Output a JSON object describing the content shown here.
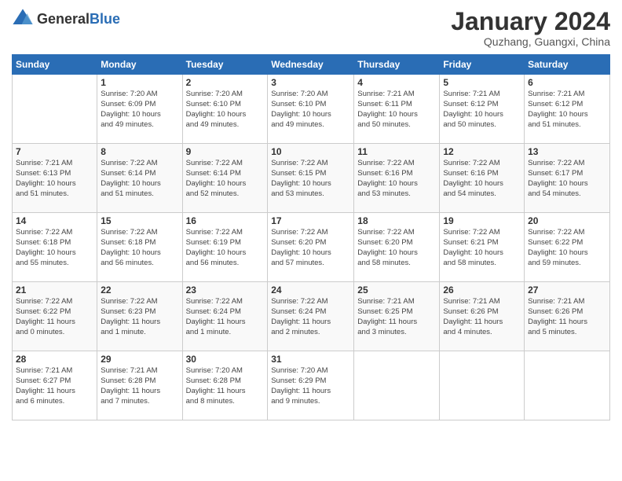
{
  "logo": {
    "general": "General",
    "blue": "Blue"
  },
  "header": {
    "month": "January 2024",
    "location": "Quzhang, Guangxi, China"
  },
  "days_of_week": [
    "Sunday",
    "Monday",
    "Tuesday",
    "Wednesday",
    "Thursday",
    "Friday",
    "Saturday"
  ],
  "weeks": [
    [
      {
        "day": "",
        "info": ""
      },
      {
        "day": "1",
        "info": "Sunrise: 7:20 AM\nSunset: 6:09 PM\nDaylight: 10 hours\nand 49 minutes."
      },
      {
        "day": "2",
        "info": "Sunrise: 7:20 AM\nSunset: 6:10 PM\nDaylight: 10 hours\nand 49 minutes."
      },
      {
        "day": "3",
        "info": "Sunrise: 7:20 AM\nSunset: 6:10 PM\nDaylight: 10 hours\nand 49 minutes."
      },
      {
        "day": "4",
        "info": "Sunrise: 7:21 AM\nSunset: 6:11 PM\nDaylight: 10 hours\nand 50 minutes."
      },
      {
        "day": "5",
        "info": "Sunrise: 7:21 AM\nSunset: 6:12 PM\nDaylight: 10 hours\nand 50 minutes."
      },
      {
        "day": "6",
        "info": "Sunrise: 7:21 AM\nSunset: 6:12 PM\nDaylight: 10 hours\nand 51 minutes."
      }
    ],
    [
      {
        "day": "7",
        "info": "Sunrise: 7:21 AM\nSunset: 6:13 PM\nDaylight: 10 hours\nand 51 minutes."
      },
      {
        "day": "8",
        "info": "Sunrise: 7:22 AM\nSunset: 6:14 PM\nDaylight: 10 hours\nand 51 minutes."
      },
      {
        "day": "9",
        "info": "Sunrise: 7:22 AM\nSunset: 6:14 PM\nDaylight: 10 hours\nand 52 minutes."
      },
      {
        "day": "10",
        "info": "Sunrise: 7:22 AM\nSunset: 6:15 PM\nDaylight: 10 hours\nand 53 minutes."
      },
      {
        "day": "11",
        "info": "Sunrise: 7:22 AM\nSunset: 6:16 PM\nDaylight: 10 hours\nand 53 minutes."
      },
      {
        "day": "12",
        "info": "Sunrise: 7:22 AM\nSunset: 6:16 PM\nDaylight: 10 hours\nand 54 minutes."
      },
      {
        "day": "13",
        "info": "Sunrise: 7:22 AM\nSunset: 6:17 PM\nDaylight: 10 hours\nand 54 minutes."
      }
    ],
    [
      {
        "day": "14",
        "info": "Sunrise: 7:22 AM\nSunset: 6:18 PM\nDaylight: 10 hours\nand 55 minutes."
      },
      {
        "day": "15",
        "info": "Sunrise: 7:22 AM\nSunset: 6:18 PM\nDaylight: 10 hours\nand 56 minutes."
      },
      {
        "day": "16",
        "info": "Sunrise: 7:22 AM\nSunset: 6:19 PM\nDaylight: 10 hours\nand 56 minutes."
      },
      {
        "day": "17",
        "info": "Sunrise: 7:22 AM\nSunset: 6:20 PM\nDaylight: 10 hours\nand 57 minutes."
      },
      {
        "day": "18",
        "info": "Sunrise: 7:22 AM\nSunset: 6:20 PM\nDaylight: 10 hours\nand 58 minutes."
      },
      {
        "day": "19",
        "info": "Sunrise: 7:22 AM\nSunset: 6:21 PM\nDaylight: 10 hours\nand 58 minutes."
      },
      {
        "day": "20",
        "info": "Sunrise: 7:22 AM\nSunset: 6:22 PM\nDaylight: 10 hours\nand 59 minutes."
      }
    ],
    [
      {
        "day": "21",
        "info": "Sunrise: 7:22 AM\nSunset: 6:22 PM\nDaylight: 11 hours\nand 0 minutes."
      },
      {
        "day": "22",
        "info": "Sunrise: 7:22 AM\nSunset: 6:23 PM\nDaylight: 11 hours\nand 1 minute."
      },
      {
        "day": "23",
        "info": "Sunrise: 7:22 AM\nSunset: 6:24 PM\nDaylight: 11 hours\nand 1 minute."
      },
      {
        "day": "24",
        "info": "Sunrise: 7:22 AM\nSunset: 6:24 PM\nDaylight: 11 hours\nand 2 minutes."
      },
      {
        "day": "25",
        "info": "Sunrise: 7:21 AM\nSunset: 6:25 PM\nDaylight: 11 hours\nand 3 minutes."
      },
      {
        "day": "26",
        "info": "Sunrise: 7:21 AM\nSunset: 6:26 PM\nDaylight: 11 hours\nand 4 minutes."
      },
      {
        "day": "27",
        "info": "Sunrise: 7:21 AM\nSunset: 6:26 PM\nDaylight: 11 hours\nand 5 minutes."
      }
    ],
    [
      {
        "day": "28",
        "info": "Sunrise: 7:21 AM\nSunset: 6:27 PM\nDaylight: 11 hours\nand 6 minutes."
      },
      {
        "day": "29",
        "info": "Sunrise: 7:21 AM\nSunset: 6:28 PM\nDaylight: 11 hours\nand 7 minutes."
      },
      {
        "day": "30",
        "info": "Sunrise: 7:20 AM\nSunset: 6:28 PM\nDaylight: 11 hours\nand 8 minutes."
      },
      {
        "day": "31",
        "info": "Sunrise: 7:20 AM\nSunset: 6:29 PM\nDaylight: 11 hours\nand 9 minutes."
      },
      {
        "day": "",
        "info": ""
      },
      {
        "day": "",
        "info": ""
      },
      {
        "day": "",
        "info": ""
      }
    ]
  ]
}
